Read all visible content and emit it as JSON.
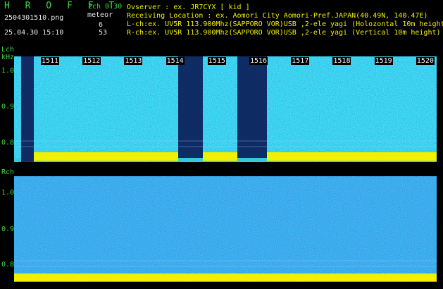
{
  "header": {
    "brand": "H R O F F T",
    "filename": "2504301510.png",
    "datetime": "25.04.30 15:10",
    "mode": "2ch 0.30",
    "type": "meteor",
    "lch_count": "6",
    "rch_count": "53",
    "observer": "Ovserver                  : ex. JR7CYX [ kid ]",
    "location": "Receiving Location : ex. Aomori City Aomori-Pref.JAPAN(40.49N, 140.47E)",
    "lch_info": "L-ch:ex. UV5R 113.900Mhz(SAPPORO VOR)USB ,2-ele yagi (Holozontal 10m height)",
    "rch_info": "R-ch:ex. UV5R 113.900Mhz(SAPPORO VOR)USB ,2-ele yagi (Vertical 10m height)"
  },
  "lch": {
    "label": "Lch",
    "unit": "kHz",
    "y_ticks": [
      "1.0",
      "0.9",
      "0.8"
    ]
  },
  "rch": {
    "label": "Rch",
    "y_ticks": [
      "1.0",
      "0.9",
      "0.8"
    ]
  },
  "time_ticks": [
    "1511",
    "1512",
    "1513",
    "1514",
    "1515",
    "1516",
    "1517",
    "1518",
    "1519",
    "1520"
  ],
  "colors": {
    "bg": "#000000",
    "label_green": "#3fd83f",
    "noise_blue": "#1e3fc0",
    "noise_cyan": "#38c8d8",
    "signal_yellow": "#f0f000"
  }
}
